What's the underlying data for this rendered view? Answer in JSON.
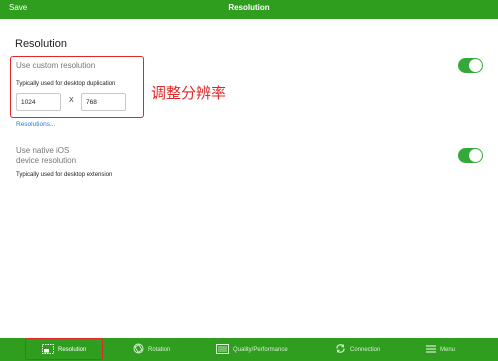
{
  "navbar": {
    "left": "Save",
    "title": "Resolution"
  },
  "section_title": "Resolution",
  "custom": {
    "label": "Use custom resolution",
    "subtitle": "Typically used for desktop duplication",
    "width": "1024",
    "separator": "X",
    "height": "768",
    "toggle_on": true
  },
  "annotation": "调整分辨率",
  "resolutions_link": "Resolutions...",
  "native": {
    "label_line1": "Use native iOS",
    "label_line2": "device resolution",
    "subtitle": "Typically used for desktop extension",
    "toggle_on": true
  },
  "tabs": [
    {
      "label": "Resolution",
      "icon": "resolution-icon"
    },
    {
      "label": "Rotation",
      "icon": "rotation-icon"
    },
    {
      "label": "Quality/Performance",
      "icon": "quality-icon"
    },
    {
      "label": "Connection",
      "icon": "connection-icon"
    },
    {
      "label": "Menu",
      "icon": "menu-icon"
    }
  ],
  "colors": {
    "brand_green": "#2f9e1f",
    "toggle_green": "#34a93a",
    "annotation_red": "#e02828",
    "link_blue": "#2a7bd6"
  }
}
